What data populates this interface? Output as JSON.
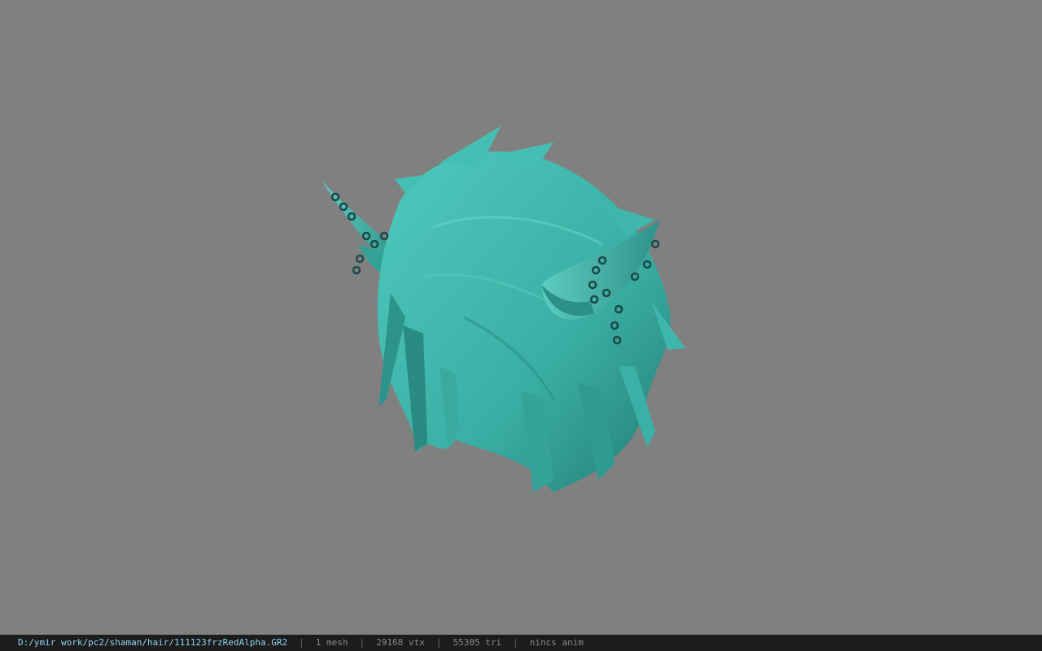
{
  "viewer": {
    "background_color": "#808080",
    "model_color": "#3fb8ae",
    "model_shadow_color": "#1f7a72",
    "chain_color": "#1a4a48"
  },
  "statusbar": {
    "file_path": "D:/ymir work/pc2/shaman/hair/111123frzRedAlpha.GR2",
    "separator": "|",
    "mesh_count": "1 mesh",
    "vertex_count": "29168 vtx",
    "triangle_count": "55305 tri",
    "animation": "nincs anim"
  }
}
